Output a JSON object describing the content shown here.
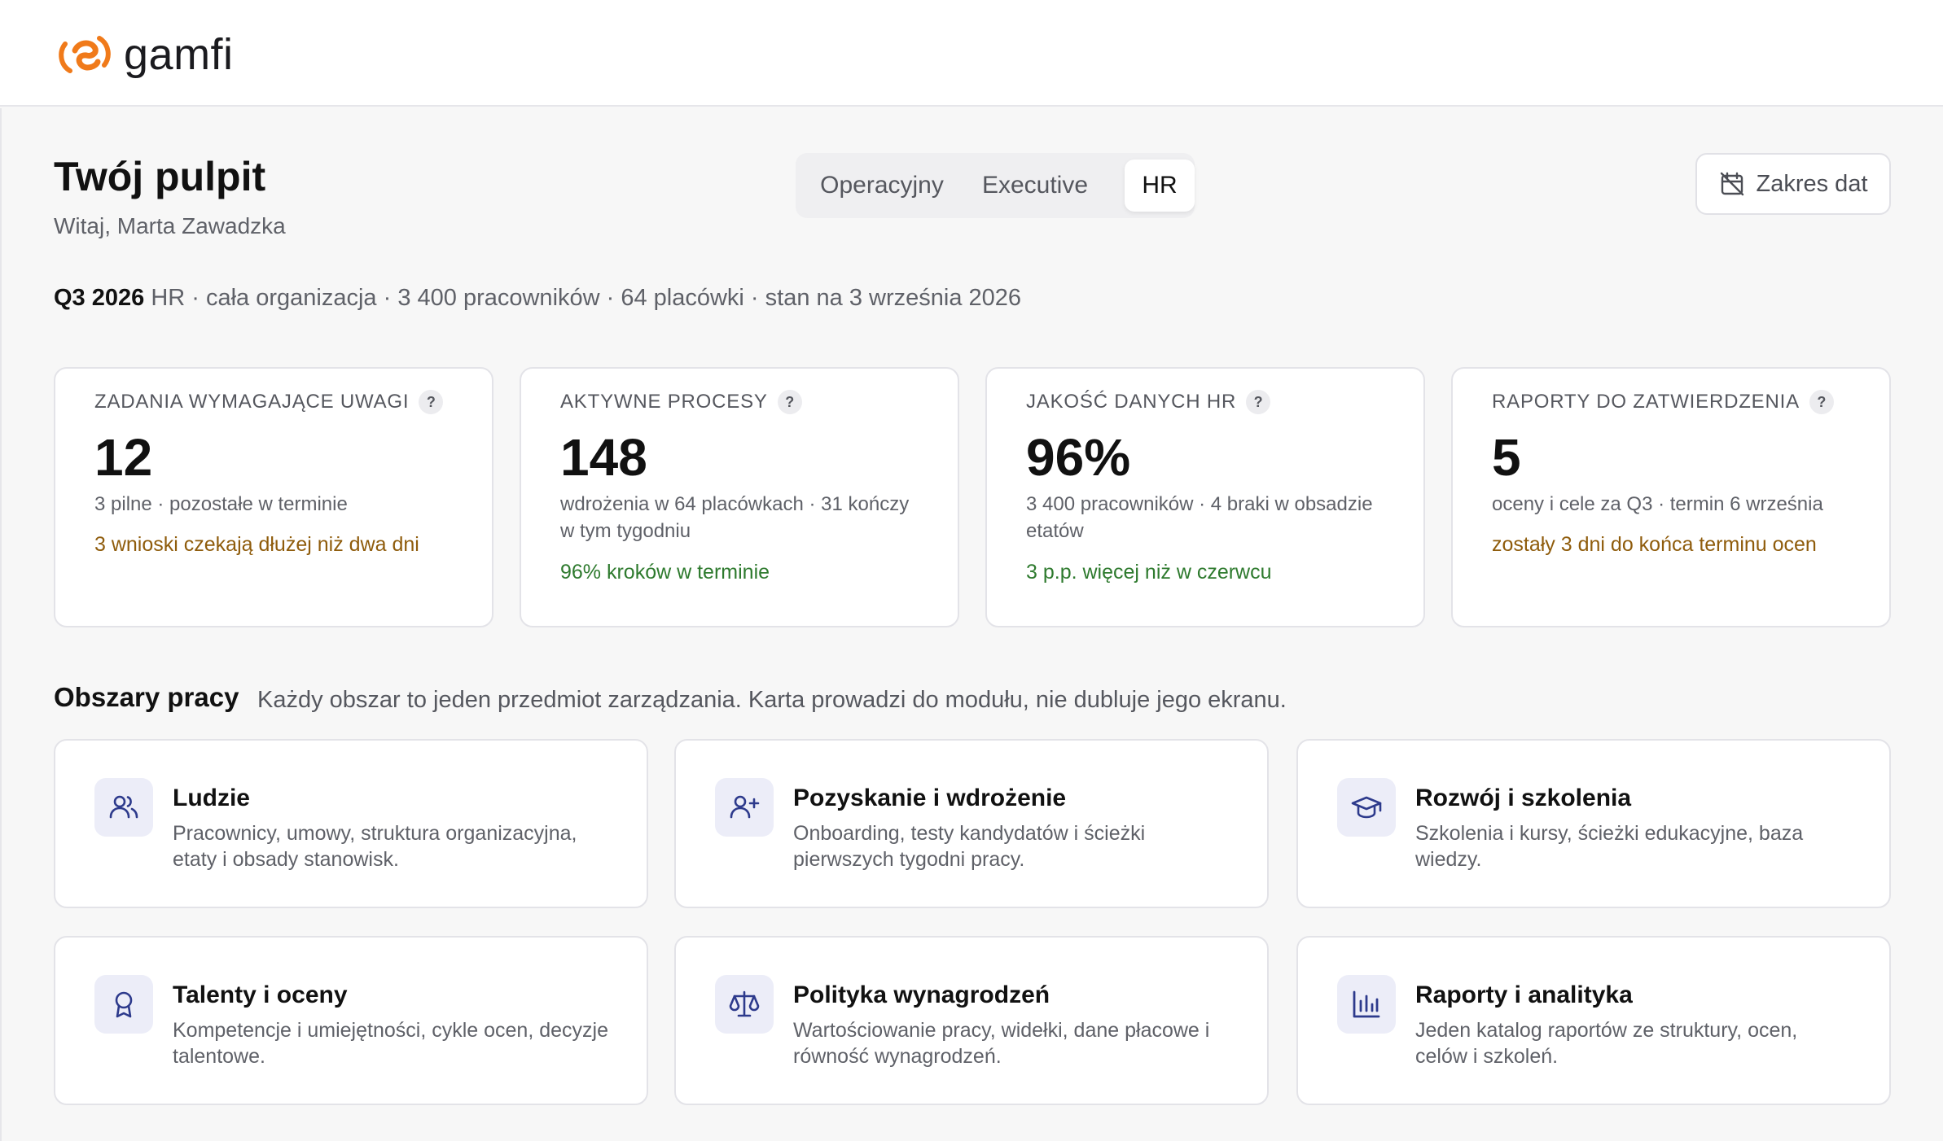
{
  "brand": {
    "name": "gamfi",
    "colors": {
      "logo_orange": "#f07a1a",
      "accent_indigo": "#2d3a8c",
      "amber": "#8f5c0c",
      "green": "#2e7a2e"
    }
  },
  "header": {
    "title": "Twój pulpit",
    "welcome": "Witaj, Marta Zawadzka"
  },
  "tabs": [
    {
      "label": "Operacyjny",
      "active": false
    },
    {
      "label": "Executive",
      "active": false
    },
    {
      "label": "HR",
      "active": true
    }
  ],
  "date_range": {
    "label": "Zakres dat",
    "icon": "calendar-off-icon"
  },
  "context": {
    "period": "Q3 2026",
    "details": " HR · cała organizacja · 3 400 pracowników · 64 placówki · stan na 3 września 2026"
  },
  "kpis": [
    {
      "label": "ZADANIA WYMAGAJĄCE UWAGI",
      "help": "?",
      "value": "12",
      "sub": "3 pilne · pozostałe w terminie",
      "note": "3 wnioski czekają dłużej niż dwa dni",
      "note_tone": "amber"
    },
    {
      "label": "AKTYWNE PROCESY",
      "help": "?",
      "value": "148",
      "sub": "wdrożenia w 64 placówkach · 31 kończy w tym tygodniu",
      "note": "96% kroków w terminie",
      "note_tone": "green"
    },
    {
      "label": "JAKOŚĆ DANYCH HR",
      "help": "?",
      "value": "96%",
      "sub": "3 400 pracowników · 4 braki w obsadzie etatów",
      "note": "3 p.p. więcej niż w czerwcu",
      "note_tone": "green"
    },
    {
      "label": "RAPORTY DO ZATWIERDZENIA",
      "help": "?",
      "value": "5",
      "sub": "oceny i cele za Q3 · termin 6 września",
      "note": "zostały 3 dni do końca terminu ocen",
      "note_tone": "amber"
    }
  ],
  "work_areas": {
    "title": "Obszary pracy",
    "description": "Każdy obszar to jeden przedmiot zarządzania. Karta prowadzi do modułu, nie dubluje jego ekranu.",
    "cards": [
      {
        "title": "Ludzie",
        "description": "Pracownicy, umowy, struktura organizacyjna, etaty i obsady stanowisk.",
        "icon": "users-icon"
      },
      {
        "title": "Pozyskanie i wdrożenie",
        "description": "Onboarding, testy kandydatów i ścieżki pierwszych tygodni pracy.",
        "icon": "user-plus-icon"
      },
      {
        "title": "Rozwój i szkolenia",
        "description": "Szkolenia i kursy, ścieżki edukacyjne, baza wiedzy.",
        "icon": "graduation-cap-icon"
      },
      {
        "title": "Talenty i oceny",
        "description": "Kompetencje i umiejętności, cykle ocen, decyzje talentowe.",
        "icon": "award-icon"
      },
      {
        "title": "Polityka wynagrodzeń",
        "description": "Wartościowanie pracy, widełki, dane płacowe i równość wynagrodzeń.",
        "icon": "scale-icon"
      },
      {
        "title": "Raporty i analityka",
        "description": "Jeden katalog raportów ze struktury, ocen, celów i szkoleń.",
        "icon": "bar-chart-icon"
      }
    ]
  }
}
